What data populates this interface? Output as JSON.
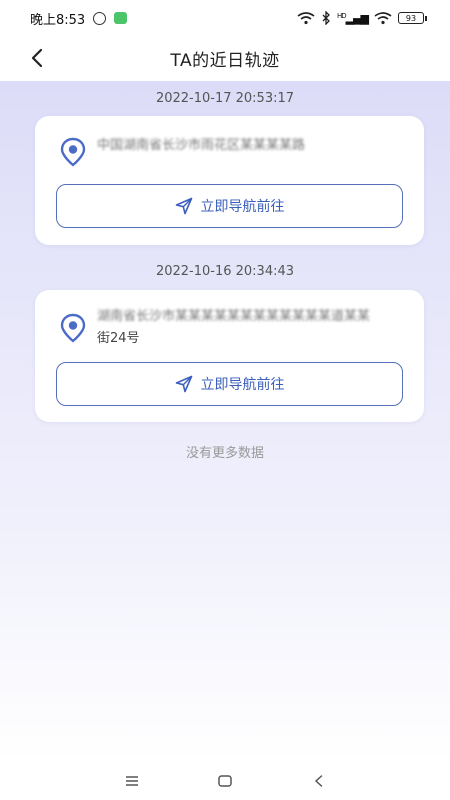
{
  "status_bar": {
    "time": "晚上8:53",
    "network_label": "HD",
    "battery_level": "93",
    "icons": [
      "alarm-icon",
      "app-badge-icon",
      "wifi-icon",
      "bluetooth-icon",
      "cellular-icon",
      "battery-icon"
    ]
  },
  "header": {
    "title": "TA的近日轨迹",
    "back_icon": "chevron-left-icon"
  },
  "records": [
    {
      "timestamp": "2022-10-17 20:53:17",
      "address": "中国湖南省长沙市雨花区某某某某路",
      "button_label": "立即导航前往"
    },
    {
      "timestamp": "2022-10-16 20:34:43",
      "address_line1": "湖南省长沙市某某某某某某某某某某某某道某某",
      "address_line2": "街24号",
      "button_label": "立即导航前往"
    }
  ],
  "footer_text": "没有更多数据",
  "colors": {
    "accent": "#3b5fbd",
    "gradient_top": "#dcdcf8",
    "pin": "#4a6bc8"
  },
  "system_nav": {
    "menu_icon": "menu-icon",
    "home_icon": "home-icon",
    "back_icon": "back-triangle-icon"
  }
}
